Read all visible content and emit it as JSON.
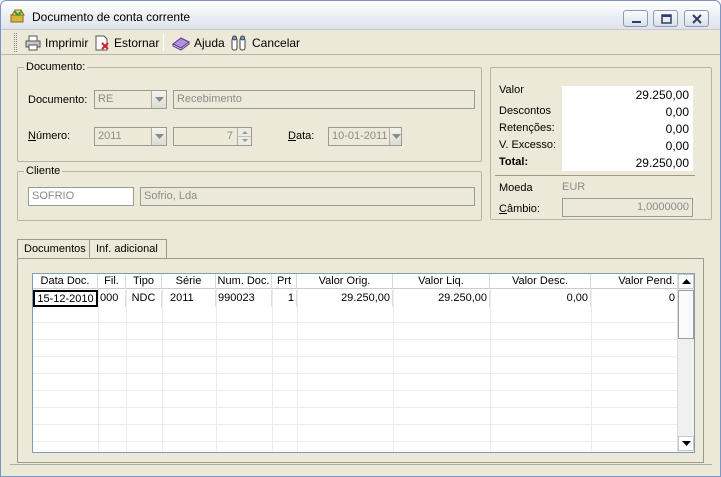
{
  "window": {
    "title": "Documento de conta corrente"
  },
  "toolbar": {
    "imprimir": "Imprimir",
    "estornar": "Estornar",
    "ajuda": "Ajuda",
    "cancelar": "Cancelar"
  },
  "documento": {
    "group_label": "Documento:",
    "tipo_label": "Documento:",
    "tipo_value": "RE",
    "tipo_desc": "Recebimento",
    "numero_label": "Número:",
    "serie_value": "2011",
    "numero_value": "7",
    "data_label": "Data:",
    "data_value": "10-01-2011"
  },
  "cliente": {
    "group_label": "Cliente",
    "code": "SOFRIO",
    "name": "Sofrio, Lda"
  },
  "totals": {
    "valor_label": "Valor",
    "valor": "29.250,00",
    "descontos_label": "Descontos",
    "descontos": "0,00",
    "retencoes_label": "Retenções:",
    "retencoes": "0,00",
    "excesso_label": "V. Excesso:",
    "excesso": "0,00",
    "total_label": "Total:",
    "total": "29.250,00",
    "moeda_label": "Moeda",
    "moeda": "EUR",
    "cambio_label": "Câmbio:",
    "cambio": "1,0000000"
  },
  "tabs": {
    "documentos": "Documentos",
    "inf_adicional": "Inf. adicional"
  },
  "grid": {
    "headers": [
      "Data Doc.",
      "Fil.",
      "Tipo",
      "Série",
      "Num. Doc.",
      "Prt",
      "Valor Orig.",
      "Valor Liq.",
      "Valor Desc.",
      "Valor Pend."
    ],
    "rows": [
      [
        "15-12-2010",
        "000",
        "NDC",
        "2011",
        "990023",
        "1",
        "29.250,00",
        "29.250,00",
        "0,00",
        "0"
      ]
    ]
  }
}
